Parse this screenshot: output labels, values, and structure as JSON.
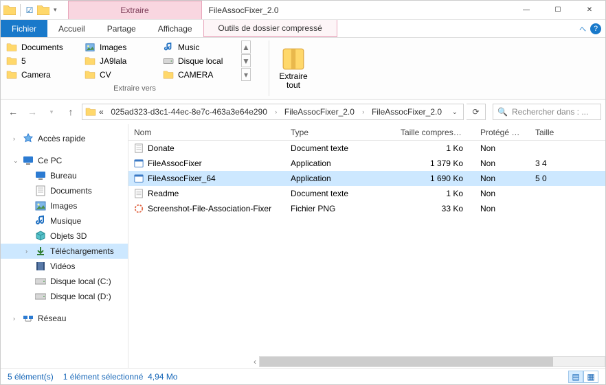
{
  "window": {
    "title": "FileAssocFixer_2.0",
    "contextual_tab": "Extraire"
  },
  "tabs": {
    "file": "Fichier",
    "home": "Accueil",
    "share": "Partage",
    "view": "Affichage",
    "compressed": "Outils de dossier compressé"
  },
  "ribbon": {
    "group_label": "Extraire vers",
    "extract_all": {
      "line1": "Extraire",
      "line2": "tout"
    },
    "targets": [
      "Documents",
      "Images",
      "Music",
      "5",
      "JA9lala",
      "Disque local",
      "Camera",
      "CV",
      "CAMERA"
    ]
  },
  "breadcrumb": {
    "prefix": "«",
    "items": [
      "025ad323-d3c1-44ec-8e7c-463a3e64e290",
      "FileAssocFixer_2.0",
      "FileAssocFixer_2.0"
    ]
  },
  "search": {
    "placeholder": "Rechercher dans : ..."
  },
  "sidebar": {
    "quick": "Accès rapide",
    "thispc": "Ce PC",
    "thispc_items": [
      "Bureau",
      "Documents",
      "Images",
      "Musique",
      "Objets 3D",
      "Téléchargements",
      "Vidéos",
      "Disque local (C:)",
      "Disque local (D:)"
    ],
    "network": "Réseau"
  },
  "columns": {
    "name": "Nom",
    "type": "Type",
    "csize": "Taille compressée",
    "protected": "Protégé pa...",
    "size": "Taille"
  },
  "files": [
    {
      "name": "Donate",
      "type": "Document texte",
      "csize": "1 Ko",
      "prot": "Non",
      "size": "",
      "icon": "text"
    },
    {
      "name": "FileAssocFixer",
      "type": "Application",
      "csize": "1 379 Ko",
      "prot": "Non",
      "size": "3 4",
      "icon": "app"
    },
    {
      "name": "FileAssocFixer_64",
      "type": "Application",
      "csize": "1 690 Ko",
      "prot": "Non",
      "size": "5 0",
      "icon": "app",
      "selected": true
    },
    {
      "name": "Readme",
      "type": "Document texte",
      "csize": "1 Ko",
      "prot": "Non",
      "size": "",
      "icon": "text"
    },
    {
      "name": "Screenshot-File-Association-Fixer",
      "type": "Fichier PNG",
      "csize": "33 Ko",
      "prot": "Non",
      "size": "",
      "icon": "png"
    }
  ],
  "status": {
    "count": "5 élément(s)",
    "selection": "1 élément sélectionné",
    "size": "4,94 Mo"
  }
}
